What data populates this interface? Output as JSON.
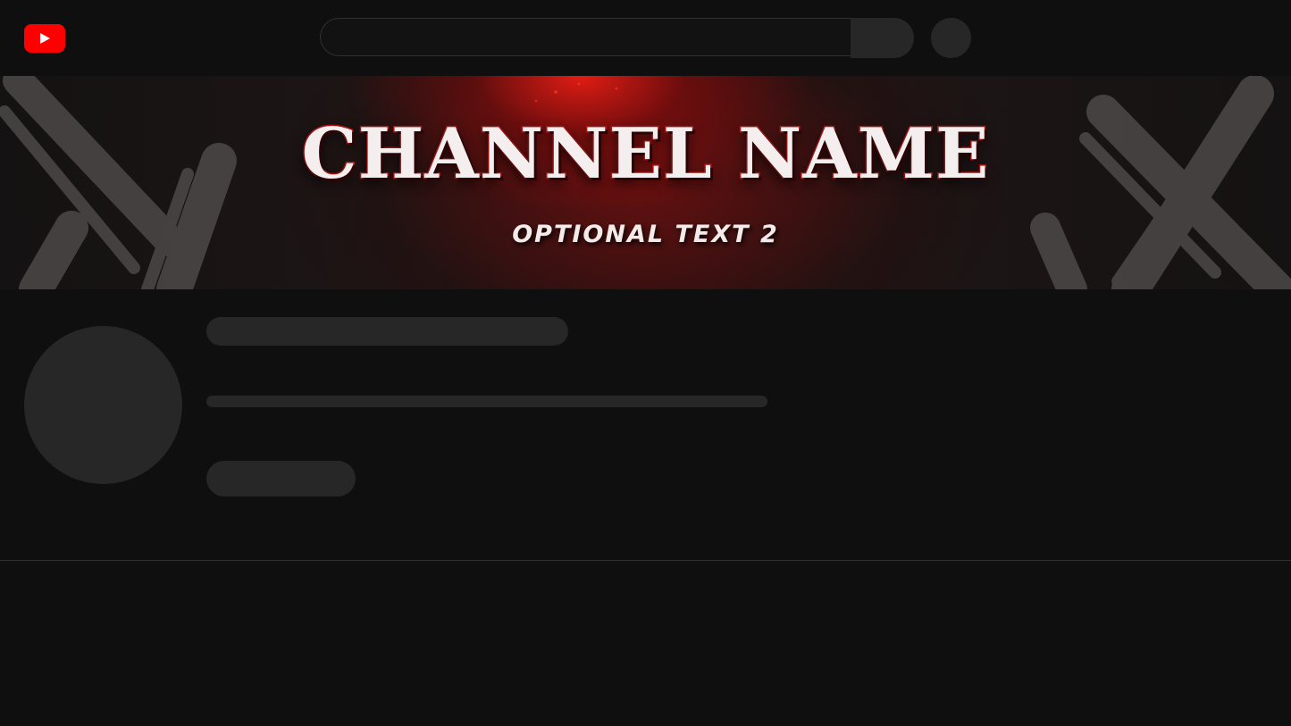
{
  "header": {
    "logo_icon": "youtube-play-icon",
    "brand_color": "#ff0000",
    "search": {
      "value": "",
      "placeholder": ""
    },
    "search_button_icon": "search-icon",
    "account_avatar": "account-avatar"
  },
  "banner": {
    "title": "CHANNEL NAME",
    "subtitle": "OPTIONAL TEXT 2",
    "accent_color": "#c21414"
  },
  "channel": {
    "avatar": "channel-avatar-placeholder",
    "name_placeholder": "",
    "description_placeholder": "",
    "subscribe_placeholder": ""
  }
}
